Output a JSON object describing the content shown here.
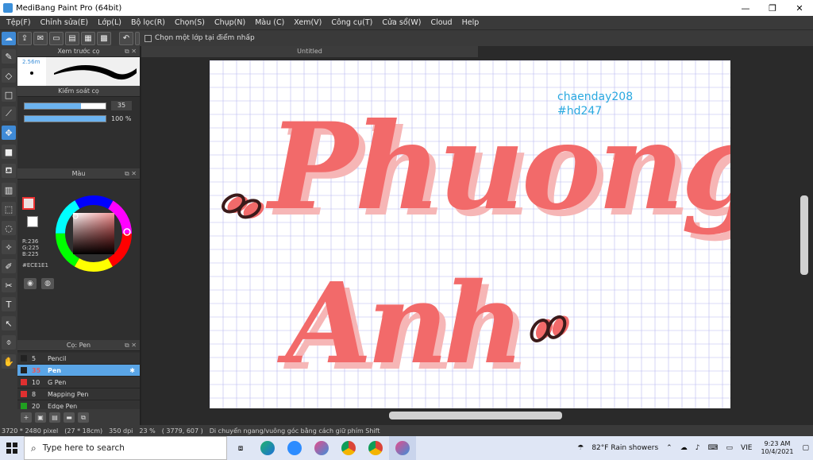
{
  "window": {
    "title": "MediBang Paint Pro (64bit)"
  },
  "menu": [
    "Tệp(F)",
    "Chỉnh sửa(E)",
    "Lớp(L)",
    "Bộ lọc(R)",
    "Chọn(S)",
    "Chụp(N)",
    "Màu (C)",
    "Xem(V)",
    "Công cụ(T)",
    "Cửa sổ(W)",
    "Cloud",
    "Help"
  ],
  "toolbar": {
    "checkbox_label": "Chọn một lớp tại điểm nhấp"
  },
  "panels": {
    "brush_preview": {
      "title": "Xem trước cọ",
      "size": "2.56m"
    },
    "brush_control": {
      "title": "Kiểm soát cọ",
      "size_value": 35,
      "size_fraction": 0.7,
      "opacity_label": "100 %",
      "opacity_fraction": 1.0
    },
    "color": {
      "title": "Màu",
      "r": "R:236",
      "g": "G:225",
      "b": "B:225",
      "hex": "#ECE1E1",
      "fg": "#ECE1E1"
    },
    "brush_list": {
      "title": "Cọ: Pen",
      "items": [
        {
          "num": "5",
          "name": "Pencil",
          "color": "#222222"
        },
        {
          "num": "35",
          "name": "Pen",
          "color": "#222222",
          "selected": true
        },
        {
          "num": "10",
          "name": "G Pen",
          "color": "#e03030"
        },
        {
          "num": "8",
          "name": "Mapping Pen",
          "color": "#e03030"
        },
        {
          "num": "20",
          "name": "Edge Pen",
          "color": "#20a020"
        }
      ]
    }
  },
  "document": {
    "tab": "Untitled"
  },
  "canvas": {
    "watermark_line1": "chaenday208",
    "watermark_line2": "#hd247",
    "text_line1": "Phuong",
    "text_line2": "Anh",
    "ink_color": "#f26a6a",
    "shadow_color": "#f6b6b6",
    "grid_color": "#b8b8f0"
  },
  "status": {
    "size": "3720 * 2480 pixel",
    "cm": "(27 * 18cm)",
    "dpi": "350 dpi",
    "zoom": "23 %",
    "coords": "( 3779, 607 )",
    "hint": "Di chuyển ngang/vuông góc bằng cách giữ phím Shift"
  },
  "taskbar": {
    "search_placeholder": "Type here to search",
    "weather": "82°F Rain showers",
    "lang": "VIE",
    "time": "9:23 AM",
    "date": "10/4/2021"
  }
}
